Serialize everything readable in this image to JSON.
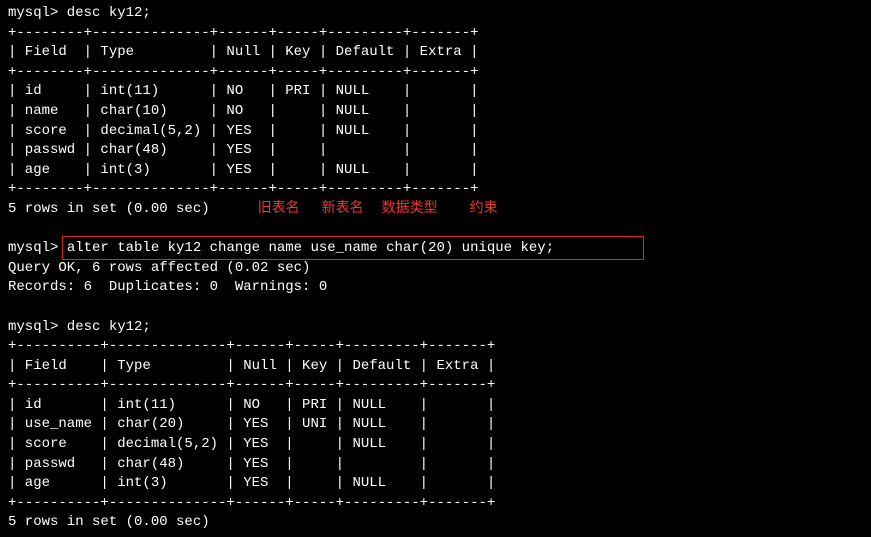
{
  "prompt1": "mysql> desc ky12;",
  "table1": {
    "sep": "+--------+--------------+------+-----+---------+-------+",
    "header": "| Field  | Type         | Null | Key | Default | Extra |",
    "r1": "| id     | int(11)      | NO   | PRI | NULL    |       |",
    "r2": "| name   | char(10)     | NO   |     | NULL    |       |",
    "r3": "| score  | decimal(5,2) | YES  |     | NULL    |       |",
    "r4": "| passwd | char(48)     | YES  |     |         |       |",
    "r5": "| age    | int(3)       | YES  |     | NULL    |       |"
  },
  "result1": "5 rows in set (0.00 sec)",
  "labels": {
    "old_name": "旧表名",
    "new_name": "新表名",
    "data_type": "数据类型",
    "constraint": "约束"
  },
  "blank": " ",
  "prompt2_pre": "mysql> ",
  "prompt2_cmd": "alter table ky12 change name use_name char(20) unique key;",
  "affected": "Query OK, 6 rows affected (0.02 sec)",
  "records": "Records: 6  Duplicates: 0  Warnings: 0",
  "prompt3": "mysql> desc ky12;",
  "table2": {
    "sep": "+----------+--------------+------+-----+---------+-------+",
    "header": "| Field    | Type         | Null | Key | Default | Extra |",
    "r1": "| id       | int(11)      | NO   | PRI | NULL    |       |",
    "r2": "| use_name | char(20)     | YES  | UNI | NULL    |       |",
    "r3": "| score    | decimal(5,2) | YES  |     | NULL    |       |",
    "r4": "| passwd   | char(48)     | YES  |     |         |       |",
    "r5": "| age      | int(3)       | YES  |     | NULL    |       |"
  },
  "result2": "5 rows in set (0.00 sec)"
}
